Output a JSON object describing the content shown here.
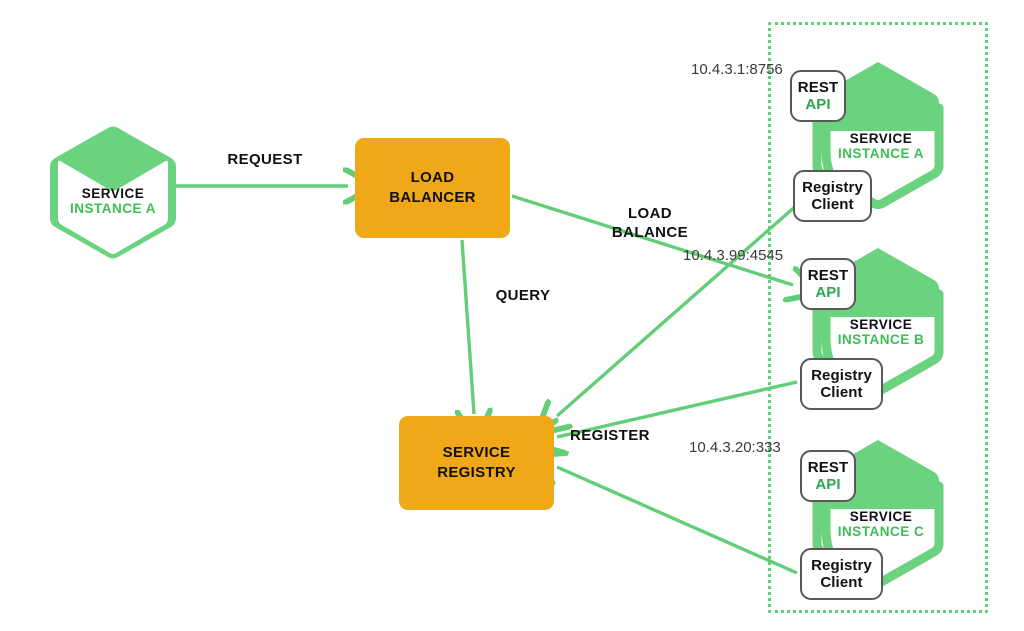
{
  "theme": {
    "green": "#6BD27F",
    "green_line": "#62CE78",
    "green_text": "#3DBF55",
    "orange": "#F0A818",
    "chip_border": "#595959",
    "zone_border": "#5BD074",
    "text": "#111111",
    "ip_text": "#3b3b3b"
  },
  "nodes": {
    "client_service": {
      "title": "SERVICE",
      "subtitle": "INSTANCE A"
    },
    "load_balancer": {
      "label": "LOAD\nBALANCER"
    },
    "service_registry": {
      "label": "SERVICE\nREGISTRY"
    }
  },
  "edges": {
    "request": {
      "label": "REQUEST"
    },
    "load_balance": {
      "label": "LOAD\nBALANCE"
    },
    "query": {
      "label": "QUERY"
    },
    "register": {
      "label": "REGISTER"
    }
  },
  "zone": {
    "name": "service-instances-zone"
  },
  "instances": [
    {
      "id": "instance-a",
      "address": "10.4.3.1:8756",
      "rest_api": {
        "line1": "REST",
        "line2": "API"
      },
      "registry_client": {
        "line1": "Registry",
        "line2": "Client"
      },
      "title": "SERVICE",
      "subtitle": "INSTANCE A"
    },
    {
      "id": "instance-b",
      "address": "10.4.3.99:4545",
      "rest_api": {
        "line1": "REST",
        "line2": "API"
      },
      "registry_client": {
        "line1": "Registry",
        "line2": "Client"
      },
      "title": "SERVICE",
      "subtitle": "INSTANCE B"
    },
    {
      "id": "instance-c",
      "address": "10.4.3.20:333",
      "rest_api": {
        "line1": "REST",
        "line2": "API"
      },
      "registry_client": {
        "line1": "Registry",
        "line2": "Client"
      },
      "title": "SERVICE",
      "subtitle": "INSTANCE C"
    }
  ]
}
